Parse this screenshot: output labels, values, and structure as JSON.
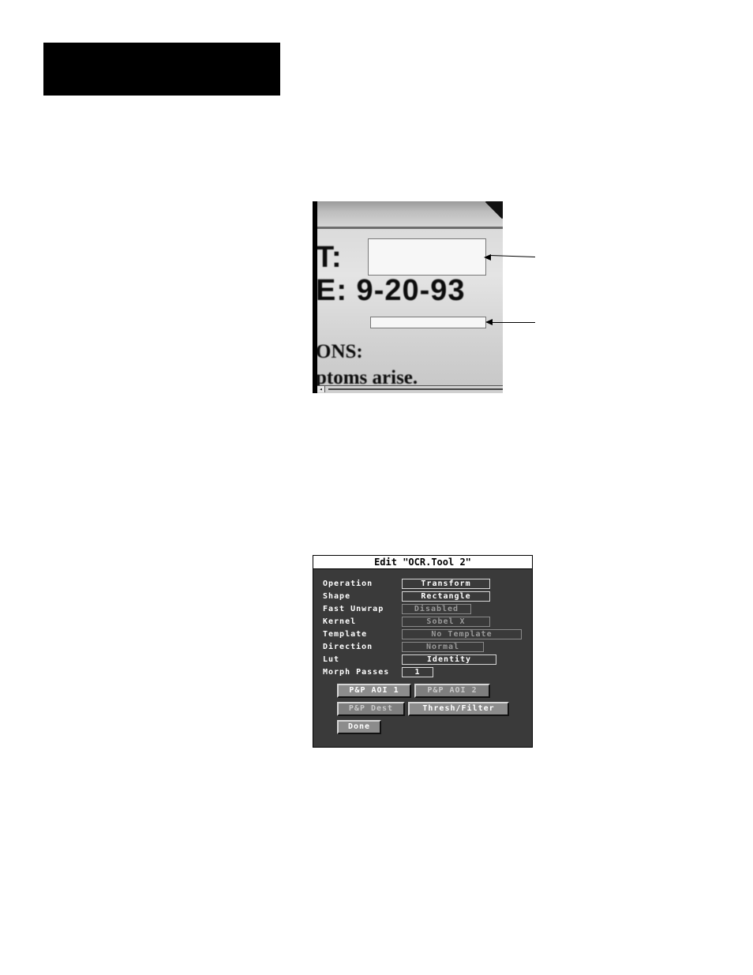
{
  "camera_view": {
    "text_line1": "T:",
    "text_line2": "E: 9-20-93",
    "text_line3": "ONS:",
    "text_line4": "ptoms arise.",
    "scroll_left_glyph": "◂"
  },
  "dialog": {
    "title": "Edit \"OCR.Tool 2\"",
    "fields": [
      {
        "label": "Operation",
        "value": "Transform",
        "enabled": true
      },
      {
        "label": "Shape",
        "value": "Rectangle",
        "enabled": true
      },
      {
        "label": "Fast Unwrap",
        "value": "Disabled",
        "enabled": false
      },
      {
        "label": "Kernel",
        "value": "Sobel X",
        "enabled": false
      },
      {
        "label": "Template",
        "value": "No Template",
        "enabled": false
      },
      {
        "label": "Direction",
        "value": "Normal",
        "enabled": false
      },
      {
        "label": "Lut",
        "value": "Identity",
        "enabled": true
      },
      {
        "label": "Morph Passes",
        "value": "1",
        "enabled": true
      }
    ],
    "buttons": {
      "pp_aoi1": "P&P AOI 1",
      "pp_aoi2": "P&P AOI 2",
      "pp_dest": "P&P Dest",
      "thresh_filter": "Thresh/Filter",
      "done": "Done"
    }
  }
}
